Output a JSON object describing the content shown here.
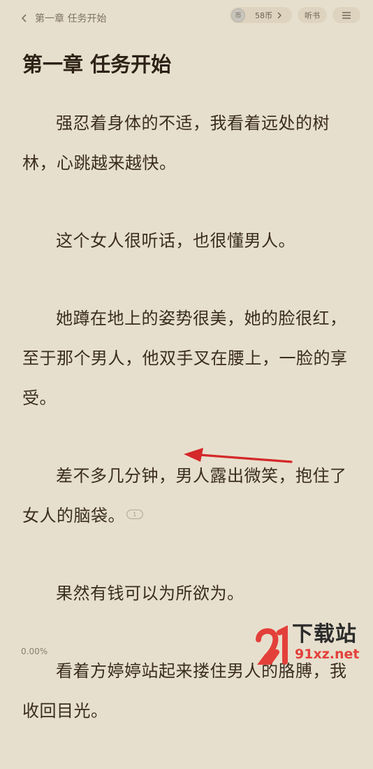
{
  "header": {
    "back_label": "第一章 任务开始",
    "coins_label": "58币",
    "coin_icon_glyph": "币",
    "listen_label": "听书"
  },
  "chapter": {
    "title": "第一章 任务开始",
    "paragraphs": [
      "强忍着身体的不适，我看着远处的树林，心跳越来越快。",
      "这个女人很听话，也很懂男人。",
      "她蹲在地上的姿势很美，她的脸很红，至于那个男人，他双手叉在腰上，一脸的享受。",
      "差不多几分钟，男人露出微笑，抱住了女人的脑袋。",
      "果然有钱可以为所欲为。",
      "看着方婷婷站起来搂住男人的胳膊，我收回目光。"
    ],
    "comment_count": "1"
  },
  "footer": {
    "progress": "0.00%"
  },
  "watermark": {
    "text": "下载站",
    "domain": "91xz.net"
  },
  "colors": {
    "background": "#e7dfcd",
    "text": "#3a2d20",
    "annotation_arrow": "#d4282a"
  },
  "icons": [
    "chevron-left-icon",
    "coin-icon",
    "chevron-right-icon",
    "menu-icon",
    "comment-bubble-icon"
  ]
}
